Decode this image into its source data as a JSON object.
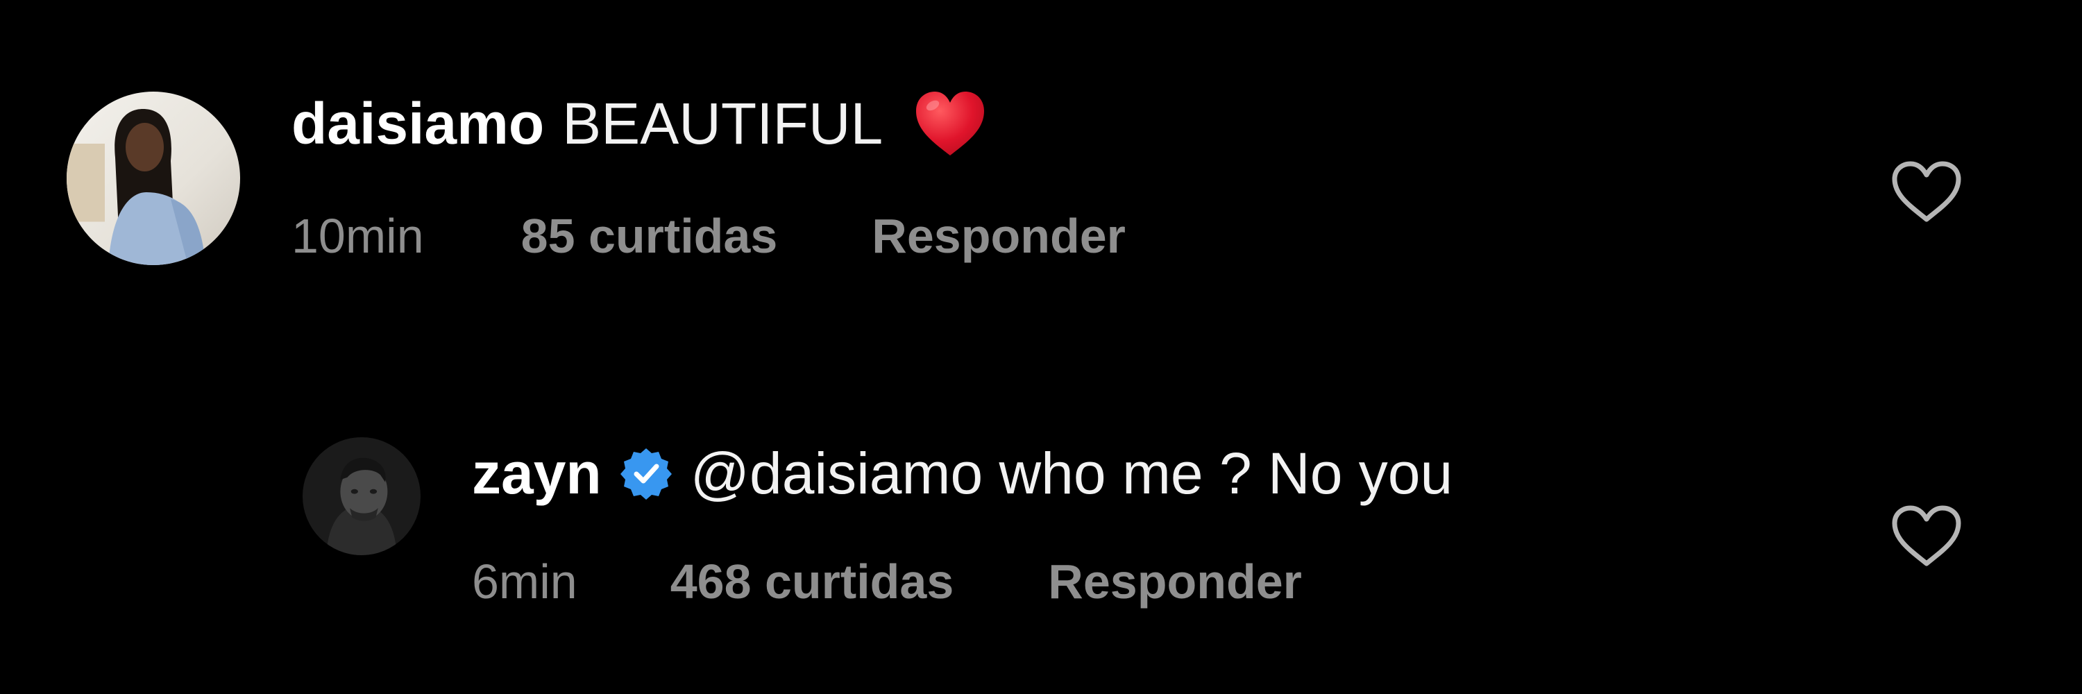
{
  "comments": [
    {
      "username": "daisiamo",
      "text": "BEAUTIFUL",
      "emoji": "red-heart-emoji",
      "time": "10min",
      "likes": "85 curtidas",
      "reply_label": "Responder",
      "avatar": "user-avatar-photo",
      "like_icon": "heart-outline-icon"
    },
    {
      "username": "zayn",
      "verified": true,
      "verified_icon": "verified-badge-icon",
      "text": "@daisiamo who me ? No you",
      "time": "6min",
      "likes": "468 curtidas",
      "reply_label": "Responder",
      "avatar": "user-avatar-photo",
      "like_icon": "heart-outline-icon"
    }
  ],
  "colors": {
    "background": "#000000",
    "text_primary": "#ffffff",
    "text_secondary": "#8e8e8e",
    "verified_blue": "#3897f0",
    "emoji_red": "#e0142b"
  }
}
